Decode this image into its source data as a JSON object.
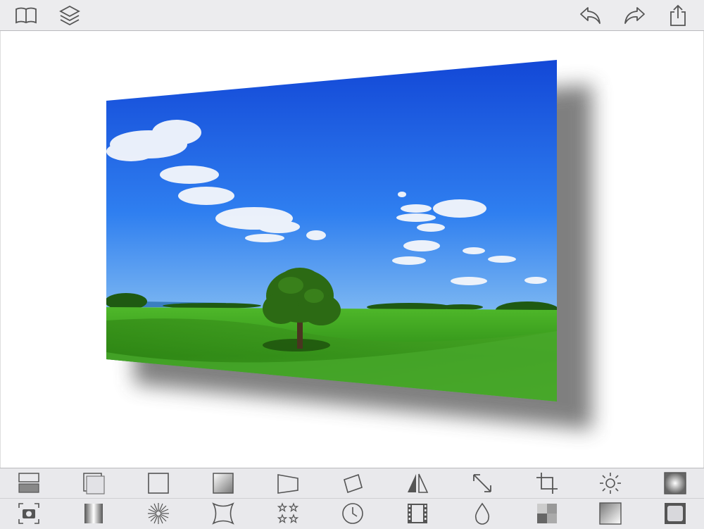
{
  "app": {
    "accent": "#007aff",
    "icon_color": "#555555"
  },
  "topbar": {
    "left_icons": [
      "book-icon",
      "layers-icon"
    ],
    "right_icons": [
      "undo-icon",
      "redo-icon",
      "share-icon"
    ]
  },
  "canvas": {
    "photo_subject": "landscape-photo",
    "sky_color": "#1d63e8",
    "grass_color": "#3a9a1c"
  },
  "toolbar_row1": [
    "frame-style-icon",
    "double-frame-icon",
    "square-frame-icon",
    "gradient-frame-icon",
    "perspective-icon",
    "rotate-icon",
    "flip-icon",
    "resize-icon",
    "crop-icon",
    "brightness-icon",
    "vignette-icon"
  ],
  "toolbar_row2": [
    "camera-icon",
    "linear-gradient-icon",
    "starburst-icon",
    "distort-icon",
    "stars-icon",
    "timer-icon",
    "film-strip-icon",
    "drop-icon",
    "pixelate-icon",
    "shading-icon",
    "rounded-frame-icon"
  ]
}
